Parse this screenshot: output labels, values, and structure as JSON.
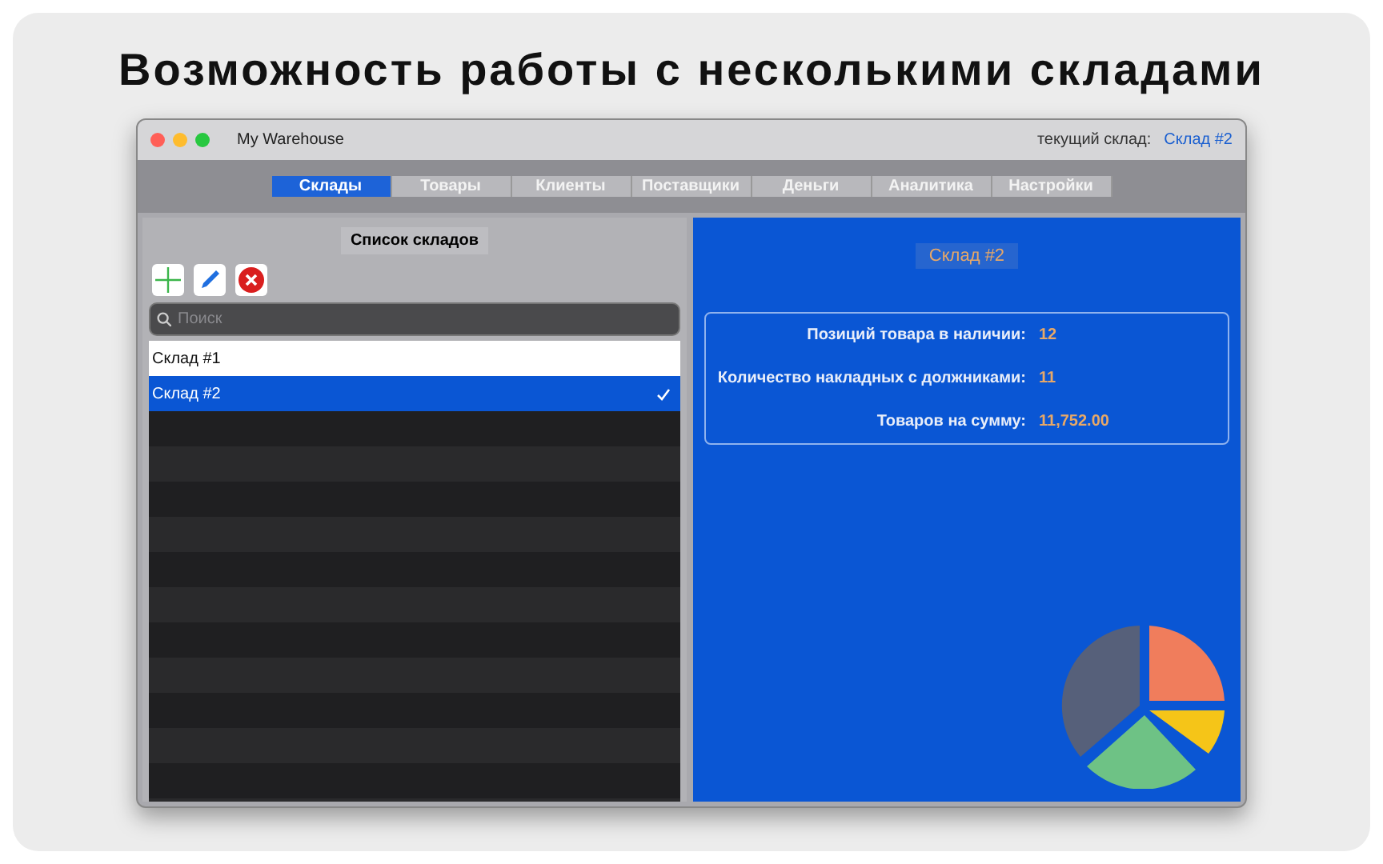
{
  "heading": "Возможность работы с несколькими складами",
  "window": {
    "title": "My Warehouse",
    "current_label": "текущий склад:",
    "current_value": "Склад #2"
  },
  "tabs": [
    {
      "label": "Склады",
      "selected": true
    },
    {
      "label": "Товары",
      "selected": false
    },
    {
      "label": "Клиенты",
      "selected": false
    },
    {
      "label": "Поставщики",
      "selected": false
    },
    {
      "label": "Деньги",
      "selected": false
    },
    {
      "label": "Аналитика",
      "selected": false
    },
    {
      "label": "Настройки",
      "selected": false
    }
  ],
  "sidebar": {
    "title": "Список складов",
    "search": {
      "placeholder": "Поиск"
    },
    "items": [
      {
        "label": "Склад #1",
        "selected": false
      },
      {
        "label": "Склад #2",
        "selected": true
      }
    ]
  },
  "detail": {
    "title": "Склад #2",
    "stats": [
      {
        "label": "Позиций товара в наличии:",
        "value": "12"
      },
      {
        "label": "Количество накладных с должниками:",
        "value": "11"
      },
      {
        "label": "Товаров на сумму:",
        "value": "11,752.00"
      }
    ]
  }
}
